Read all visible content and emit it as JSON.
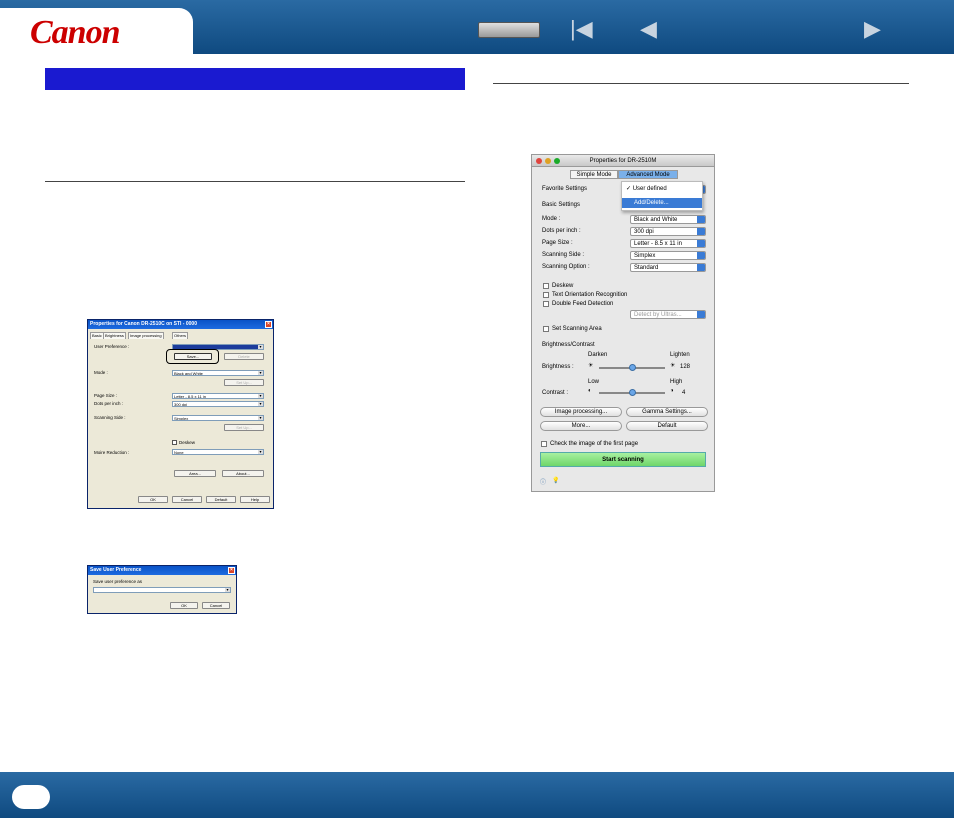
{
  "header": {
    "logo": "Canon",
    "nav_back_first": "|◀",
    "nav_back": "◀",
    "nav_forward": "▶"
  },
  "win1": {
    "title": "Properties for Canon DR-2510C on STI - 0000",
    "tabs": [
      "Basic",
      "Brightness",
      "Image processing",
      "Others"
    ],
    "user_pref_label": "User Preference :",
    "save_btn": "Save...",
    "delete_btn": "Delete",
    "mode_label": "Mode :",
    "mode_value": "Black and White",
    "setup_btn": "Set Up...",
    "page_size_label": "Page Size :",
    "page_size_value": "Letter - 8.5 x 11 in",
    "dpi_label": "Dots per inch :",
    "dpi_value": "300 dpi",
    "side_label": "Scanning Side :",
    "side_value": "Simplex",
    "setup_btn2": "Set Up...",
    "deskew": "Deskew",
    "moire_label": "Moire Reduction :",
    "moire_value": "None",
    "area_btn": "Area...",
    "about_btn": "About...",
    "ok": "OK",
    "cancel": "Cancel",
    "default": "Default",
    "help": "Help"
  },
  "win2": {
    "title": "Save User Preference",
    "label": "Save user preference as",
    "ok": "OK",
    "cancel": "Cancel"
  },
  "mac": {
    "title": "Properties for DR-2510M",
    "simple_mode": "Simple Mode",
    "advanced_mode": "Advanced Mode",
    "favorite_label": "Favorite Settings",
    "menu_selected": "✓ User defined",
    "menu_add": "Add/Delete...",
    "basic_settings": "Basic Settings",
    "mode_label": "Mode :",
    "mode_value": "Black and White",
    "dpi_label": "Dots per inch :",
    "dpi_value": "300 dpi",
    "page_label": "Page Size :",
    "page_value": "Letter - 8.5 x 11 in",
    "side_label": "Scanning Side :",
    "side_value": "Simplex",
    "option_label": "Scanning Option :",
    "option_value": "Standard",
    "deskew": "Deskew",
    "text_orient": "Text Orientation Recognition",
    "double_feed": "Double Feed Detection",
    "detect_by": "Detect by Ultras...",
    "set_area": "Set Scanning Area",
    "bc_title": "Brightness/Contrast",
    "darken": "Darken",
    "lighten": "Lighten",
    "brightness_label": "Brightness :",
    "brightness_value": "128",
    "low": "Low",
    "high": "High",
    "contrast_label": "Contrast :",
    "contrast_value": "4",
    "image_processing": "Image processing...",
    "gamma": "Gamma Settings...",
    "more": "More...",
    "default": "Default",
    "check_first": "Check the image of the first page",
    "start": "Start scanning"
  }
}
